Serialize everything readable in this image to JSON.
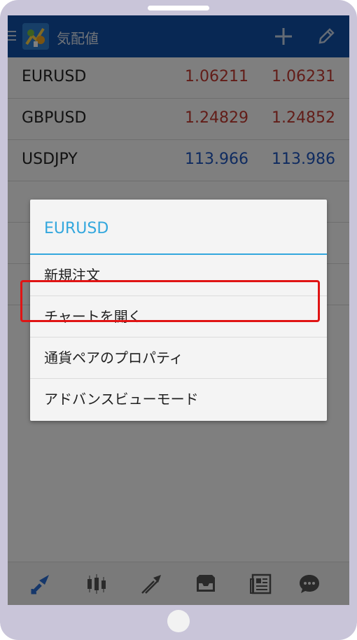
{
  "app_bar": {
    "title": "気配値",
    "icons": [
      "menu-icon",
      "app-logo",
      "add-icon",
      "edit-icon"
    ]
  },
  "quotes": [
    {
      "symbol": "EURUSD",
      "bid": "1.06211",
      "ask": "1.06231",
      "direction": "down"
    },
    {
      "symbol": "GBPUSD",
      "bid": "1.24829",
      "ask": "1.24852",
      "direction": "down"
    },
    {
      "symbol": "USDJPY",
      "bid": "113.966",
      "ask": "113.986",
      "direction": "up"
    }
  ],
  "dialog": {
    "title": "EURUSD",
    "items": [
      {
        "label": "新規注文"
      },
      {
        "label": "チャートを開く",
        "highlighted": true
      },
      {
        "label": "通貨ペアのプロパティ"
      },
      {
        "label": "アドバンスビューモード"
      }
    ]
  },
  "bottom_nav": {
    "items": [
      "quotes-icon",
      "chart-icon",
      "trade-icon",
      "history-icon",
      "news-icon",
      "messages-icon"
    ],
    "active": "quotes-icon"
  },
  "colors": {
    "app_bar": "#1150a8",
    "price_down": "#c43a31",
    "price_up": "#1f57c0",
    "dialog_accent": "#33a7dd",
    "highlight": "#e01414",
    "nav_active": "#2a6fd6",
    "nav_inactive": "#555555"
  }
}
